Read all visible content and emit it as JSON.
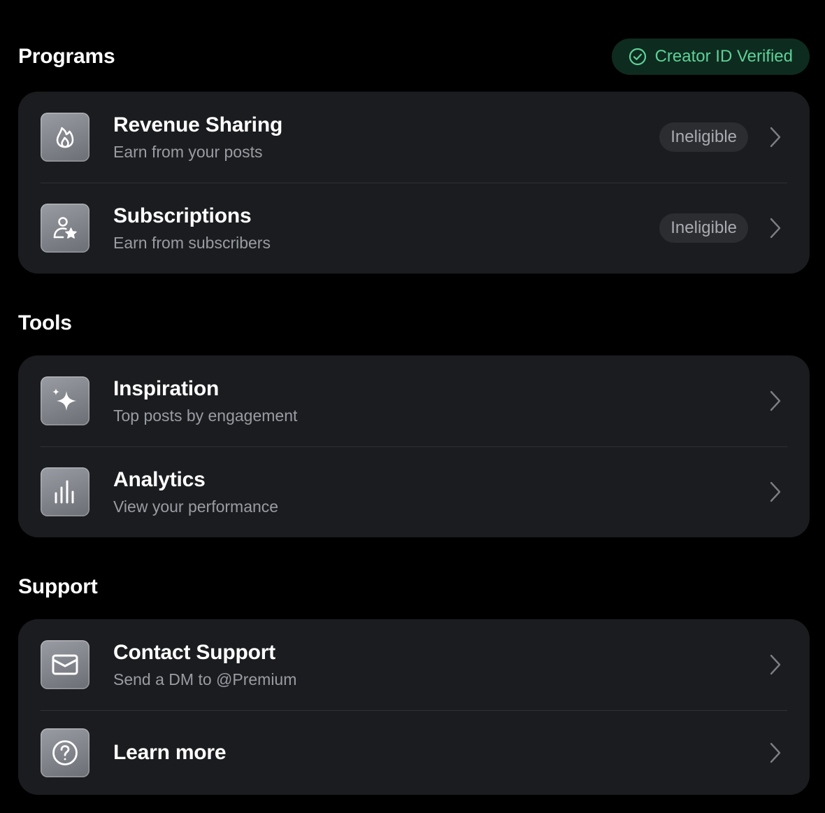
{
  "programs": {
    "title": "Programs",
    "badge": {
      "label": "Creator ID Verified",
      "icon": "check-circle-icon",
      "color": "#5ed197"
    },
    "items": [
      {
        "title": "Revenue Sharing",
        "subtitle": "Earn from your posts",
        "status": "Ineligible",
        "icon": "flame-icon"
      },
      {
        "title": "Subscriptions",
        "subtitle": "Earn from subscribers",
        "status": "Ineligible",
        "icon": "person-star-icon"
      }
    ]
  },
  "tools": {
    "title": "Tools",
    "items": [
      {
        "title": "Inspiration",
        "subtitle": "Top posts by engagement",
        "icon": "sparkle-icon"
      },
      {
        "title": "Analytics",
        "subtitle": "View your performance",
        "icon": "bar-chart-icon"
      }
    ]
  },
  "support": {
    "title": "Support",
    "items": [
      {
        "title": "Contact Support",
        "subtitle": "Send a DM to @Premium",
        "icon": "envelope-icon"
      },
      {
        "title": "Learn more",
        "icon": "question-circle-icon"
      }
    ]
  }
}
